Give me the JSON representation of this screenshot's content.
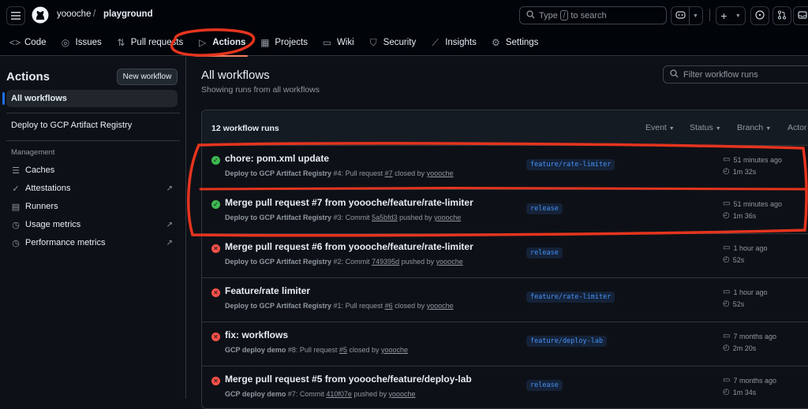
{
  "header": {
    "owner": "yoooche",
    "separator": "/",
    "repo": "playground",
    "search_prefix": "Type",
    "search_key": "/",
    "search_suffix": "to search",
    "icons": [
      "menu-icon",
      "github-logo",
      "search-icon",
      "copilot-icon",
      "plus-icon",
      "issues-icon",
      "pull-request-icon",
      "inbox-icon"
    ]
  },
  "tabs": [
    {
      "label": "Code",
      "icon": "code-icon"
    },
    {
      "label": "Issues",
      "icon": "issue-icon"
    },
    {
      "label": "Pull requests",
      "icon": "pull-request-icon"
    },
    {
      "label": "Actions",
      "icon": "play-icon",
      "active": true
    },
    {
      "label": "Projects",
      "icon": "table-icon"
    },
    {
      "label": "Wiki",
      "icon": "book-icon"
    },
    {
      "label": "Security",
      "icon": "shield-icon"
    },
    {
      "label": "Insights",
      "icon": "graph-icon"
    },
    {
      "label": "Settings",
      "icon": "gear-icon"
    }
  ],
  "sidebar": {
    "title": "Actions",
    "new_workflow": "New workflow",
    "all_workflows": "All workflows",
    "workflow": "Deploy to GCP Artifact Registry",
    "management_heading": "Management",
    "management": [
      {
        "label": "Caches",
        "icon": "database-icon"
      },
      {
        "label": "Attestations",
        "icon": "verified-icon",
        "external": true
      },
      {
        "label": "Runners",
        "icon": "server-icon"
      },
      {
        "label": "Usage metrics",
        "icon": "meter-icon",
        "external": true
      },
      {
        "label": "Performance metrics",
        "icon": "pulse-icon",
        "external": true
      }
    ]
  },
  "main": {
    "title": "All workflows",
    "subtitle": "Showing runs from all workflows",
    "filter_placeholder": "Filter workflow runs",
    "runs_count": "12 workflow runs",
    "filters": [
      "Event",
      "Status",
      "Branch",
      "Actor"
    ],
    "runs": [
      {
        "status": "success",
        "title": "chore: pom.xml update",
        "workflow": "Deploy to GCP Artifact Registry",
        "num": "#4",
        "trigger": ": Pull request ",
        "ref": "#7",
        "action": " closed by ",
        "actor": "yoooche",
        "branch": "feature/rate-limiter",
        "time": "51 minutes ago",
        "duration": "1m 32s"
      },
      {
        "status": "success",
        "title": "Merge pull request #7 from yoooche/feature/rate-limiter",
        "workflow": "Deploy to GCP Artifact Registry",
        "num": "#3",
        "trigger": ": Commit ",
        "ref": "5a5bfd3",
        "action": " pushed by ",
        "actor": "yoooche",
        "branch": "release",
        "time": "51 minutes ago",
        "duration": "1m 36s"
      },
      {
        "status": "failure",
        "title": "Merge pull request #6 from yoooche/feature/rate-limiter",
        "workflow": "Deploy to GCP Artifact Registry",
        "num": "#2",
        "trigger": ": Commit ",
        "ref": "749395d",
        "action": " pushed by ",
        "actor": "yoooche",
        "branch": "release",
        "time": "1 hour ago",
        "duration": "52s"
      },
      {
        "status": "failure",
        "title": "Feature/rate limiter",
        "workflow": "Deploy to GCP Artifact Registry",
        "num": "#1",
        "trigger": ": Pull request ",
        "ref": "#6",
        "action": " closed by ",
        "actor": "yoooche",
        "branch": "feature/rate-limiter",
        "time": "1 hour ago",
        "duration": "52s"
      },
      {
        "status": "failure",
        "title": "fix: workflows",
        "workflow": "GCP deploy demo",
        "num": "#8",
        "trigger": ": Pull request ",
        "ref": "#5",
        "action": " closed by ",
        "actor": "yoooche",
        "branch": "feature/deploy-lab",
        "time": "7 months ago",
        "duration": "2m 20s"
      },
      {
        "status": "failure",
        "title": "Merge pull request #5 from yoooche/feature/deploy-lab",
        "workflow": "GCP deploy demo",
        "num": "#7",
        "trigger": ": Commit ",
        "ref": "410f07e",
        "action": " pushed by ",
        "actor": "yoooche",
        "branch": "release",
        "time": "7 months ago",
        "duration": "1m 34s"
      }
    ]
  },
  "colors": {
    "annotation": "#e5341e",
    "success": "#3fb950",
    "failure": "#f85149",
    "branch": "#4493f8"
  }
}
